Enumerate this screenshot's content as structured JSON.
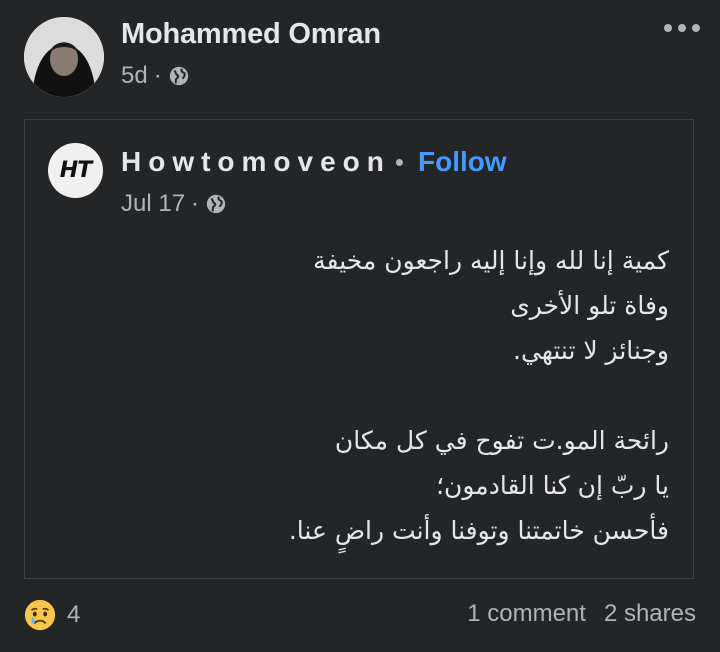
{
  "post": {
    "author_name": "Mohammed Omran",
    "time": "5d",
    "separator": "·",
    "audience_icon": "globe-icon"
  },
  "shared": {
    "page_logo_text": "HT",
    "page_name": "Howtomoveon",
    "separator": "•",
    "follow_label": "Follow",
    "date": "Jul 17",
    "meta_separator": "·",
    "text_lines": [
      "كمية إنا لله وإنا إليه راجعون مخيفة",
      "وفاة تلو الأخرى",
      "وجنائز لا تنتهي.",
      "",
      "رائحة المو.ت تفوح في كل مكان",
      "يا ربّ إن كنا القادمون؛",
      "فأحسن خاتمتنا وتوفنا وأنت راضٍ عنا."
    ]
  },
  "footer": {
    "reaction_icon": "sad-face-icon",
    "reaction_count": "4",
    "comments": "1 comment",
    "shares": "2 shares"
  },
  "colors": {
    "background": "#242526",
    "text_primary": "#e4e6eb",
    "text_secondary": "#b0b3b8",
    "link": "#4599ff",
    "border": "#3e4042"
  }
}
